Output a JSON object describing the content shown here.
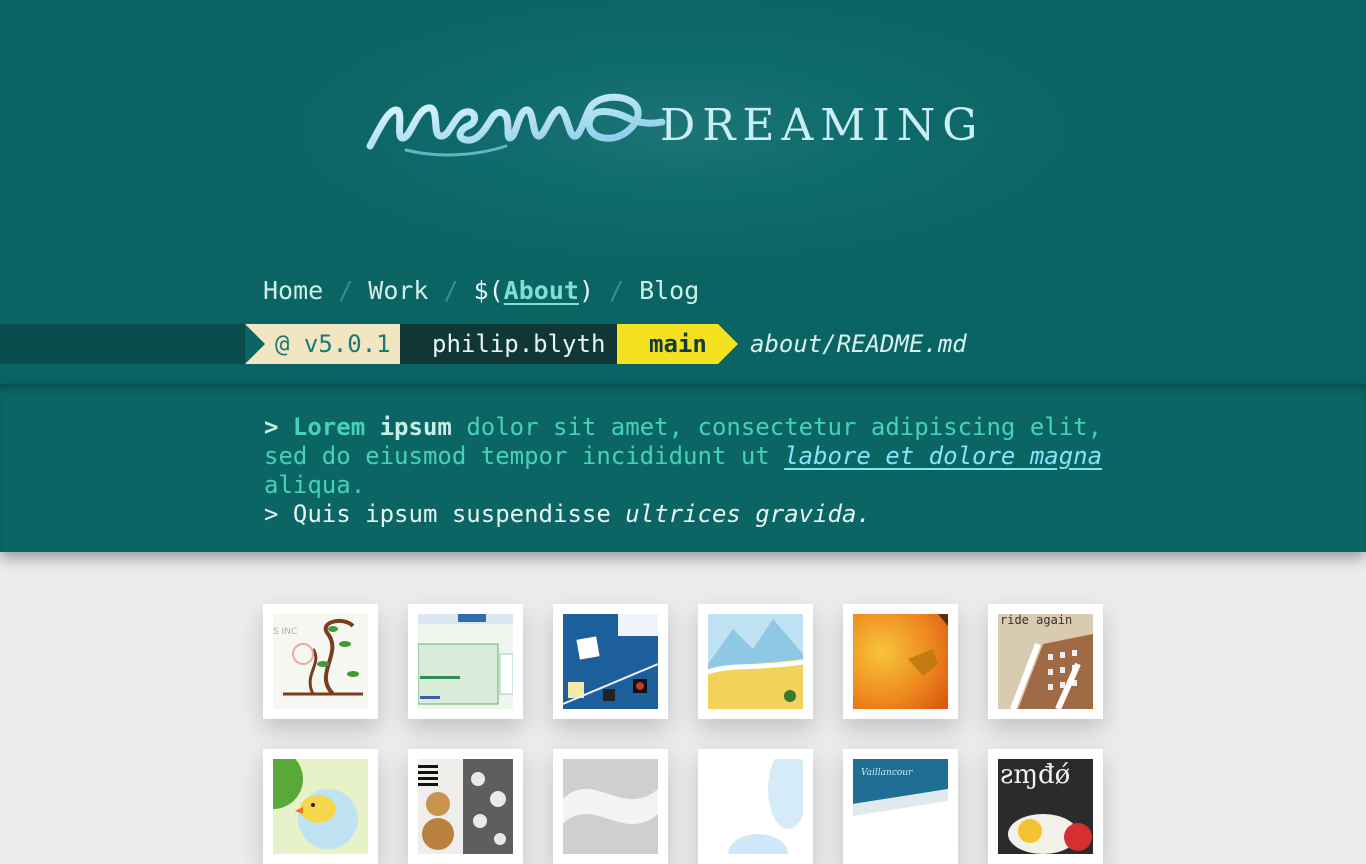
{
  "site": {
    "logo_text": "nemo dreaming",
    "logo_script": "nemo",
    "logo_word": "DREAMING"
  },
  "nav": {
    "items": [
      {
        "label": "Home"
      },
      {
        "label": "Work"
      },
      {
        "label": "About",
        "prefix": "$(",
        "suffix": ")",
        "active": true
      },
      {
        "label": "Blog"
      }
    ],
    "separator": "/"
  },
  "prompt_bar": {
    "version": "@ v5.0.1",
    "user": "philip.blyth",
    "branch": "main",
    "path": "about/README.md"
  },
  "intro": {
    "line1_marker": ">",
    "line1_bold1": "Lorem",
    "line1_bold2": "ipsum",
    "line1_rest": "dolor sit amet, consectetur adipiscing elit, sed do eiusmod tempor incididunt ut",
    "line1_link": "labore et dolore magna",
    "line1_end": "aliqua.",
    "line2_marker": ">",
    "line2_text": "Quis ipsum suspendisse",
    "line2_emph": "ultrices gravida."
  },
  "colors": {
    "header_bg": "#0b6464",
    "version_seg": "#f1e5c2",
    "user_seg": "#103636",
    "branch_seg": "#f4e120",
    "accent_text": "#47d2b8"
  },
  "thumbnails": [
    {
      "name": "vine-branding"
    },
    {
      "name": "web-search-layout"
    },
    {
      "name": "blue-game-board"
    },
    {
      "name": "mountain-field-illustration"
    },
    {
      "name": "orange-abstract"
    },
    {
      "name": "ride-again-building"
    },
    {
      "name": "bird-green-burst"
    },
    {
      "name": "bear-floral-pattern"
    },
    {
      "name": "white-ribbon-sculpture"
    },
    {
      "name": "soft-blue-shape"
    },
    {
      "name": "vaillancourt-cards"
    },
    {
      "name": "lettering-lemon"
    }
  ]
}
